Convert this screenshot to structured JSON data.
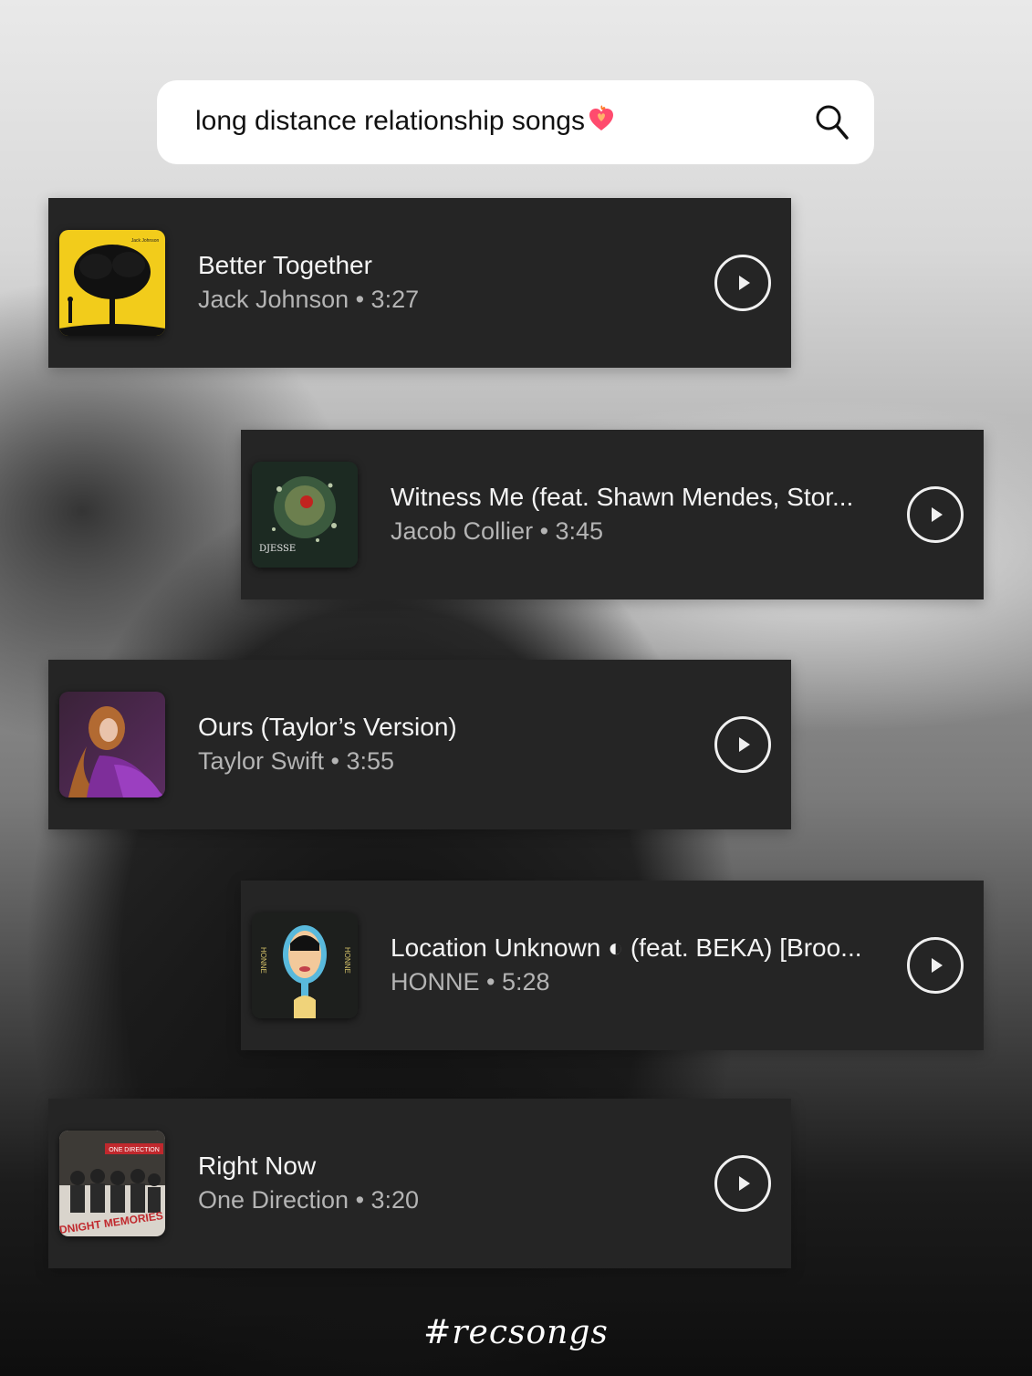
{
  "search": {
    "query": "long distance relationship songs",
    "emoji": "heart-on-fire",
    "icon": "search-icon"
  },
  "songs": [
    {
      "title": "Better Together",
      "artist": "Jack Johnson",
      "duration": "3:27",
      "subtitle": "Jack Johnson • 3:27",
      "cover_label": "Jack Johnson",
      "accent": "#f2cc1b"
    },
    {
      "title": "Witness Me (feat. Shawn Mendes, Stor...",
      "artist": "Jacob Collier",
      "duration": "3:45",
      "subtitle": "Jacob Collier • 3:45",
      "cover_label": "DJESSE",
      "accent": "#2f4a32"
    },
    {
      "title": "Ours (Taylor’s Version)",
      "artist": "Taylor Swift",
      "duration": "3:55",
      "subtitle": "Taylor Swift • 3:55",
      "accent": "#6b2f7a"
    },
    {
      "title": "Location Unknown ◐ (feat. BEKA) [Broo...",
      "artist": "HONNE",
      "duration": "5:28",
      "subtitle": "HONNE • 5:28",
      "cover_label": "HONNE",
      "accent": "#4fb7d9"
    },
    {
      "title": "Right Now",
      "artist": "One Direction",
      "duration": "3:20",
      "subtitle": "One Direction • 3:20",
      "cover_label": "MIDNIGHT MEMORIES",
      "cover_top_label": "ONE DIRECTION",
      "accent": "#c0282d"
    }
  ],
  "footer": {
    "hashtag": "#recsongs"
  }
}
